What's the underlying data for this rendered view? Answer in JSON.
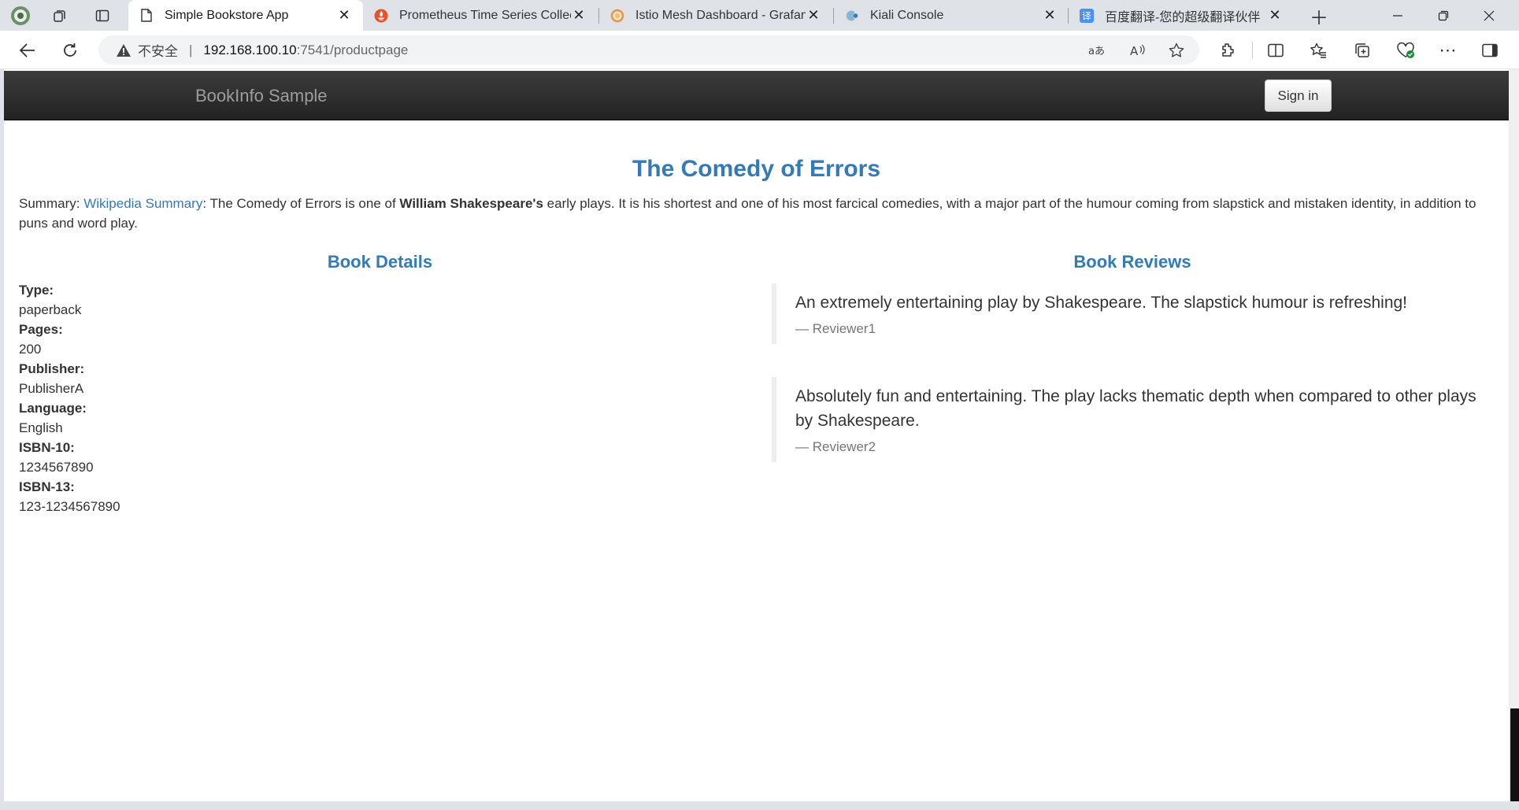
{
  "browser": {
    "tabs": [
      {
        "title": "Simple Bookstore App",
        "icon": "page-icon",
        "active": true
      },
      {
        "title": "Prometheus Time Series Collecti",
        "icon": "prometheus-icon",
        "active": false
      },
      {
        "title": "Istio Mesh Dashboard - Grafana",
        "icon": "grafana-icon",
        "active": false
      },
      {
        "title": "Kiali Console",
        "icon": "kiali-icon",
        "active": false
      },
      {
        "title": "百度翻译-您的超级翻译伙伴（文",
        "icon": "baidu-translate-icon",
        "active": false
      }
    ],
    "address": {
      "insecure_label": "不安全",
      "separator": "|",
      "host": "192.168.100.10",
      "path": ":7541/productpage"
    },
    "colors": {
      "tab_strip": "#dfe3e8",
      "accent_link": "#337ab7"
    }
  },
  "page": {
    "brand": "BookInfo Sample",
    "signin_label": "Sign in",
    "book_title": "The Comedy of Errors",
    "summary": {
      "prefix": "Summary: ",
      "link": "Wikipedia Summary",
      "text1": ": The Comedy of Errors is one of ",
      "bold": "William Shakespeare's",
      "text2": " early plays. It is his shortest and one of his most farcical comedies, with a major part of the humour coming from slapstick and mistaken identity, in addition to puns and word play."
    },
    "details_heading": "Book Details",
    "reviews_heading": "Book Reviews",
    "details": [
      {
        "label": "Type:",
        "value": "paperback"
      },
      {
        "label": "Pages:",
        "value": "200"
      },
      {
        "label": "Publisher:",
        "value": "PublisherA"
      },
      {
        "label": "Language:",
        "value": "English"
      },
      {
        "label": "ISBN-10:",
        "value": "1234567890"
      },
      {
        "label": "ISBN-13:",
        "value": "123-1234567890"
      }
    ],
    "reviews": [
      {
        "text": "An extremely entertaining play by Shakespeare. The slapstick humour is refreshing!",
        "author": "— Reviewer1"
      },
      {
        "text": "Absolutely fun and entertaining. The play lacks thematic depth when compared to other plays by Shakespeare.",
        "author": "— Reviewer2"
      }
    ]
  }
}
